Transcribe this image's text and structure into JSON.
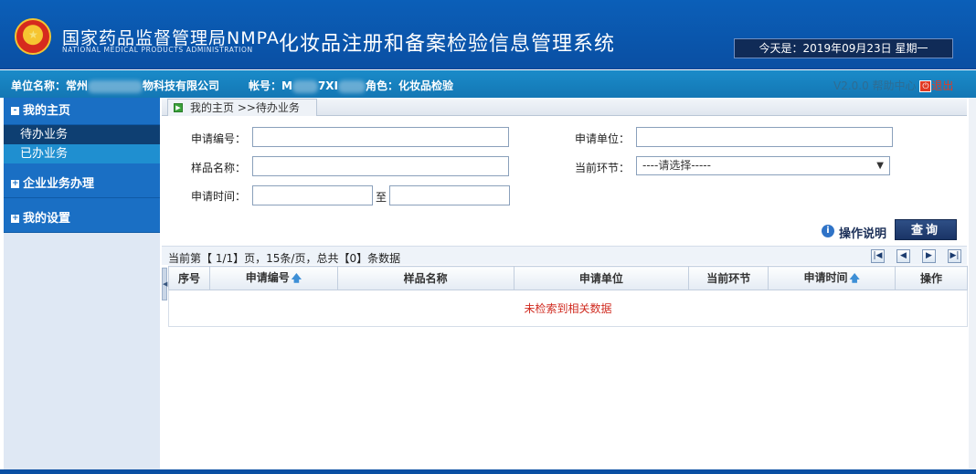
{
  "header": {
    "org_name_cn": "国家药品监督管理局NMPA",
    "org_name_en": "NATIONAL MEDICAL PRODUCTS ADMINISTRATION",
    "system_title": "化妆品注册和备案检验信息管理系统",
    "date_text": "今天是：2019年09月23日 星期一"
  },
  "infobar": {
    "unit_label": "单位名称：常州",
    "unit_suffix": "物科技有限公司",
    "account_label": "帐号：M",
    "account_suffix": "7XI",
    "role_text": "角色：化妆品检验",
    "version_help": "V2.0.0 帮助中心",
    "logout_label": "退出"
  },
  "sidebar": {
    "groups": [
      {
        "label": "我的主页",
        "toggle": "-"
      },
      {
        "label": "企业业务办理",
        "toggle": "+"
      },
      {
        "label": "我的设置",
        "toggle": "+"
      }
    ],
    "subitems": [
      {
        "label": "待办业务"
      },
      {
        "label": "已办业务"
      }
    ]
  },
  "breadcrumb": {
    "text": "我的主页 >>待办业务"
  },
  "form": {
    "app_no_label": "申请编号：",
    "app_unit_label": "申请单位：",
    "sample_name_label": "样品名称：",
    "current_stage_label": "当前环节：",
    "current_stage_value": "----请选择-----",
    "app_time_label": "申请时间：",
    "to_label": "至"
  },
  "actions": {
    "help_label": "操作说明",
    "query_label": "查询"
  },
  "pager": {
    "text": "当前第【 1/1】页，15条/页，总共【0】条数据"
  },
  "table": {
    "columns": [
      "序号",
      "申请编号",
      "样品名称",
      "申请单位",
      "当前环节",
      "申请时间",
      "操作"
    ],
    "empty_message": "未检索到相关数据"
  },
  "colors": {
    "header_blue": "#0a4fa3",
    "infobar_blue": "#1477b4",
    "sidebar_blue": "#1a6fc4",
    "empty_red": "#d02b20"
  }
}
